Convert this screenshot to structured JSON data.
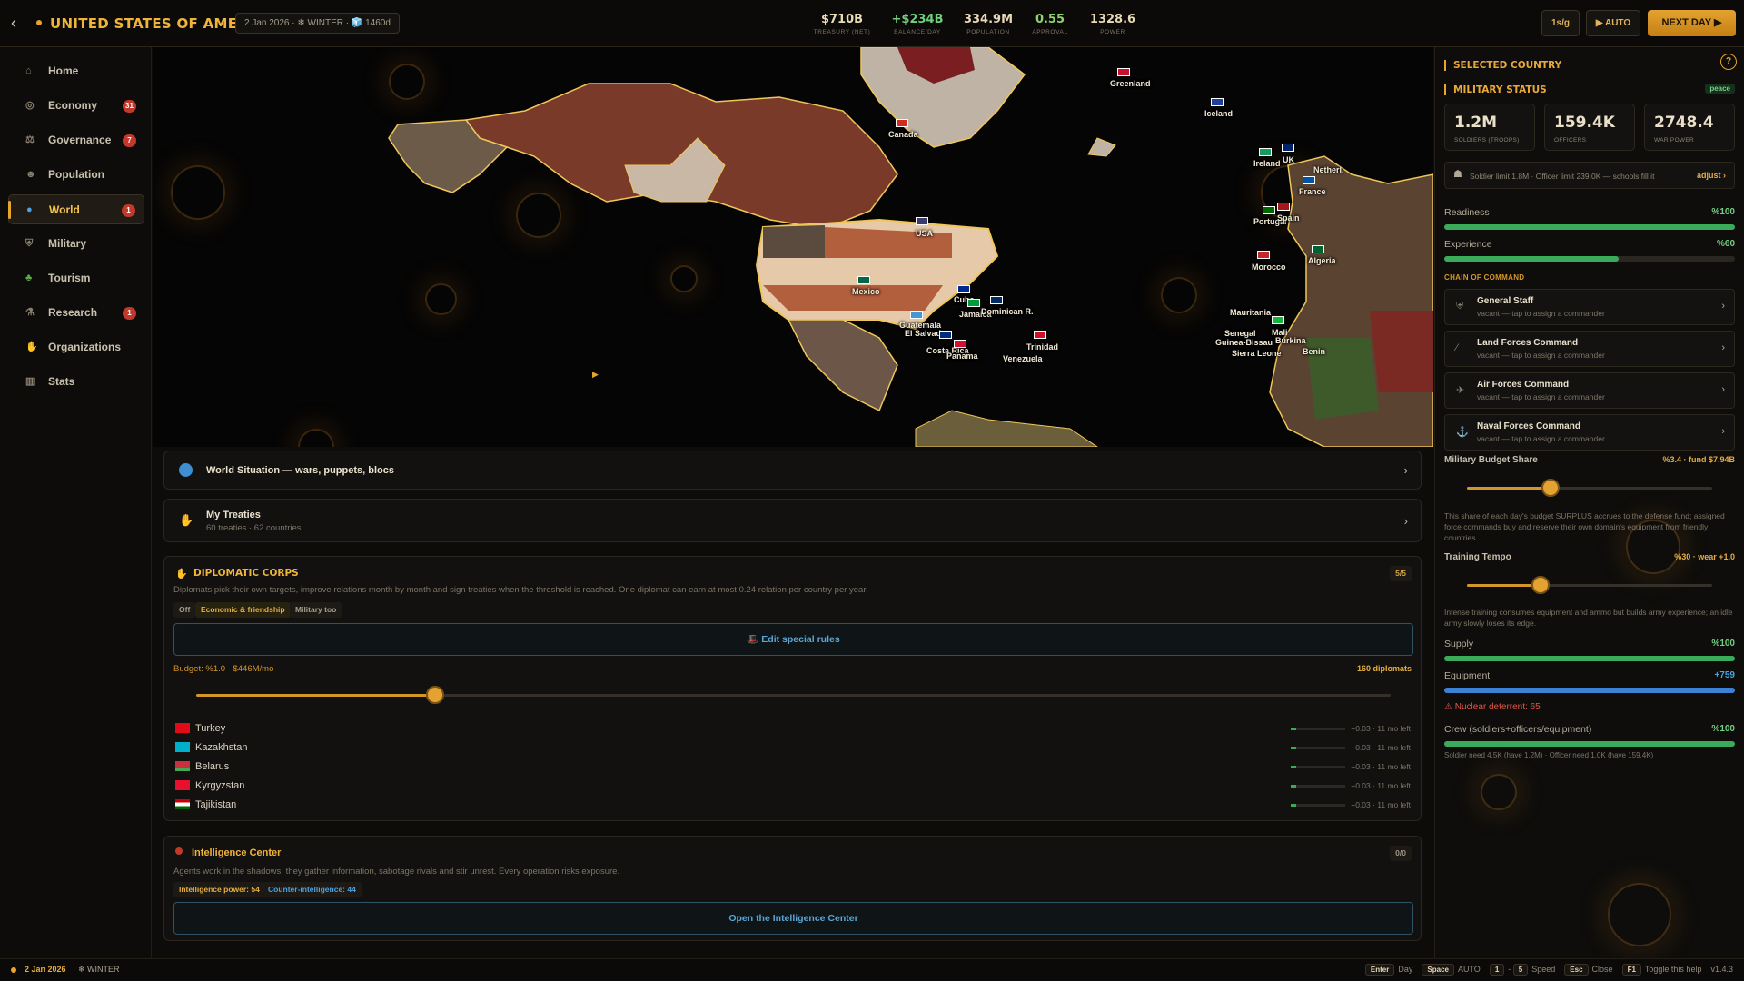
{
  "header": {
    "country": "UNITED STATES OF AMERICA",
    "date_info": "2 Jan 2026 · ❄ WINTER · 🧊 1460d",
    "stats": [
      {
        "value": "$710B",
        "label": "TREASURY (NET)"
      },
      {
        "value": "+$234B",
        "label": "BALANCE/DAY"
      },
      {
        "value": "334.9M",
        "label": "POPULATION"
      },
      {
        "value": "0.55",
        "label": "APPROVAL"
      },
      {
        "value": "1328.6",
        "label": "POWER"
      }
    ],
    "speed": "1s/g",
    "auto": "▶ AUTO",
    "next_day": "NEXT DAY ▶"
  },
  "sidebar": {
    "items": [
      {
        "label": "Home",
        "icon": "home-icon",
        "badge": ""
      },
      {
        "label": "Economy",
        "icon": "coins-icon",
        "badge": "31"
      },
      {
        "label": "Governance",
        "icon": "scales-icon",
        "badge": "7"
      },
      {
        "label": "Population",
        "icon": "people-icon",
        "badge": ""
      },
      {
        "label": "World",
        "icon": "globe-icon",
        "badge": "1"
      },
      {
        "label": "Military",
        "icon": "shield-icon",
        "badge": ""
      },
      {
        "label": "Tourism",
        "icon": "palm-icon",
        "badge": ""
      },
      {
        "label": "Research",
        "icon": "flask-icon",
        "badge": "1"
      },
      {
        "label": "Organizations",
        "icon": "handshake-icon",
        "badge": ""
      },
      {
        "label": "Stats",
        "icon": "chart-icon",
        "badge": ""
      }
    ]
  },
  "map": {
    "labels": [
      "Greenland",
      "Iceland",
      "Canada",
      "USA",
      "Mexico",
      "Cuba",
      "Jamaica",
      "Dominican R.",
      "Guatemala",
      "El Salvador",
      "Costa Rica",
      "Panama",
      "Trinidad",
      "Venezuela",
      "Ireland",
      "UK",
      "France",
      "Netherl.",
      "Portugal",
      "Spain",
      "Morocco",
      "Algeria",
      "Mauritania",
      "Mali",
      "Burkina",
      "Senegal",
      "Guinea-Bissau",
      "Sierra Leone",
      "Benin"
    ]
  },
  "world_situation": {
    "title": "World Situation — wars, puppets, blocs"
  },
  "treaties": {
    "title": "My Treaties",
    "subtitle": "60 treaties · 62 countries"
  },
  "diplomatic": {
    "title": "DIPLOMATIC CORPS",
    "count": "5/5",
    "description": "Diplomats pick their own targets, improve relations month by month and sign treaties when the threshold is reached. One diplomat can earn at most 0.24 relation per country per year.",
    "modes": [
      "Off",
      "Economic & friendship",
      "Military too"
    ],
    "edit_button": "🎩 Edit special rules",
    "budget_label": "Budget: %1.0 · $446M/mo",
    "diplomats": "160 diplomats",
    "budget_pct": 20,
    "rows": [
      {
        "name": "Turkey",
        "gain": "+0.03 · 11 mo left"
      },
      {
        "name": "Kazakhstan",
        "gain": "+0.03 · 11 mo left"
      },
      {
        "name": "Belarus",
        "gain": "+0.03 · 11 mo left"
      },
      {
        "name": "Kyrgyzstan",
        "gain": "+0.03 · 11 mo left"
      },
      {
        "name": "Tajikistan",
        "gain": "+0.03 · 11 mo left"
      }
    ]
  },
  "intel": {
    "title": "Intelligence Center",
    "count": "0/0",
    "description": "Agents work in the shadows: they gather information, sabotage rivals and stir unrest. Every operation risks exposure.",
    "power": "Intelligence power: 54",
    "counter": "Counter-intelligence: 44",
    "open_button": "Open the Intelligence Center"
  },
  "right": {
    "selected": "SELECTED COUNTRY",
    "military": "MILITARY STATUS",
    "peace": "peace",
    "help": "?",
    "cards": [
      {
        "value": "1.2M",
        "label": "SOLDIERS (TROOPS)"
      },
      {
        "value": "159.4K",
        "label": "OFFICERS"
      },
      {
        "value": "2748.4",
        "label": "WAR POWER"
      }
    ],
    "limit_text": "Soldier limit 1.8M · Officer limit 239.0K — schools fill it",
    "adjust": "adjust ›",
    "readiness": {
      "label": "Readiness",
      "value": "%100",
      "pct": 100
    },
    "experience": {
      "label": "Experience",
      "value": "%60",
      "pct": 60
    },
    "chain_title": "CHAIN OF COMMAND",
    "commands": [
      {
        "title": "General Staff",
        "sub": "vacant — tap to assign a commander",
        "icon": "shield-icon"
      },
      {
        "title": "Land Forces Command",
        "sub": "vacant — tap to assign a commander",
        "icon": "rifle-icon"
      },
      {
        "title": "Air Forces Command",
        "sub": "vacant — tap to assign a commander",
        "icon": "plane-icon"
      },
      {
        "title": "Naval Forces Command",
        "sub": "vacant — tap to assign a commander",
        "icon": "anchor-icon"
      }
    ],
    "budget_share": {
      "label": "Military Budget Share",
      "value": "%3.4 · fund $7.94B",
      "pct": 34
    },
    "budget_note": "This share of each day's budget SURPLUS accrues to the defense fund; assigned force commands buy and reserve their own domain's equipment from friendly countries.",
    "tempo": {
      "label": "Training Tempo",
      "value": "%30 · wear +1.0",
      "pct": 30
    },
    "tempo_note": "Intense training consumes equipment and ammo but builds army experience; an idle army slowly loses its edge.",
    "supply": {
      "label": "Supply",
      "value": "%100",
      "pct": 100
    },
    "equipment": {
      "label": "Equipment",
      "value": "+759",
      "pct": 100
    },
    "nuclear": "Nuclear deterrent: 65",
    "crew": {
      "label": "Crew (soldiers+officers/equipment)",
      "value": "%100",
      "pct": 100
    },
    "crew_note": "Soldier need 4.5K (have 1.2M) · Officer need 1.0K (have 159.4K)"
  },
  "footer": {
    "date": "2 Jan 2026",
    "season": "❄ WINTER",
    "keys": [
      {
        "key": "Enter",
        "label": "Day"
      },
      {
        "key": "Space",
        "label": "AUTO"
      },
      {
        "key": "1",
        "label": "-"
      },
      {
        "key": "5",
        "label": "Speed"
      },
      {
        "key": "Esc",
        "label": "Close"
      },
      {
        "key": "F1",
        "label": "Toggle this help"
      }
    ],
    "version": "v1.4.3"
  },
  "colors": {
    "accent": "#e7a52c",
    "badge": "#c0392b",
    "good": "#3aaa5b",
    "info": "#3b82d6"
  }
}
